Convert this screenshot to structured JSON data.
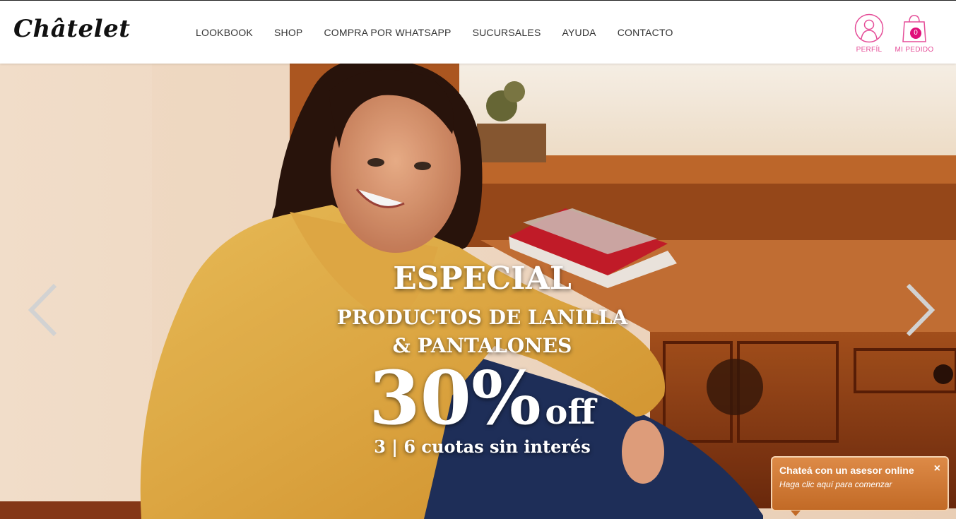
{
  "header": {
    "logo": "Châtelet",
    "nav": [
      "LOOKBOOK",
      "SHOP",
      "COMPRA POR WHATSAPP",
      "SUCURSALES",
      "AYUDA",
      "CONTACTO"
    ],
    "profile_label": "PERFÍL",
    "order_label": "MI PEDIDO",
    "cart_count": "0",
    "accent_color": "#e54d98"
  },
  "hero": {
    "line1": "ESPECIAL",
    "line2": "PRODUCTOS DE LANILLA",
    "line3": "& PANTALONES",
    "discount": "30%",
    "discount_suffix": "off",
    "installments": "3 | 6 cuotas sin interés"
  },
  "chat": {
    "title": "Chateá con un asesor online",
    "subtitle": "Haga clic aquí para comenzar",
    "close": "×",
    "color": "#d07b36"
  }
}
